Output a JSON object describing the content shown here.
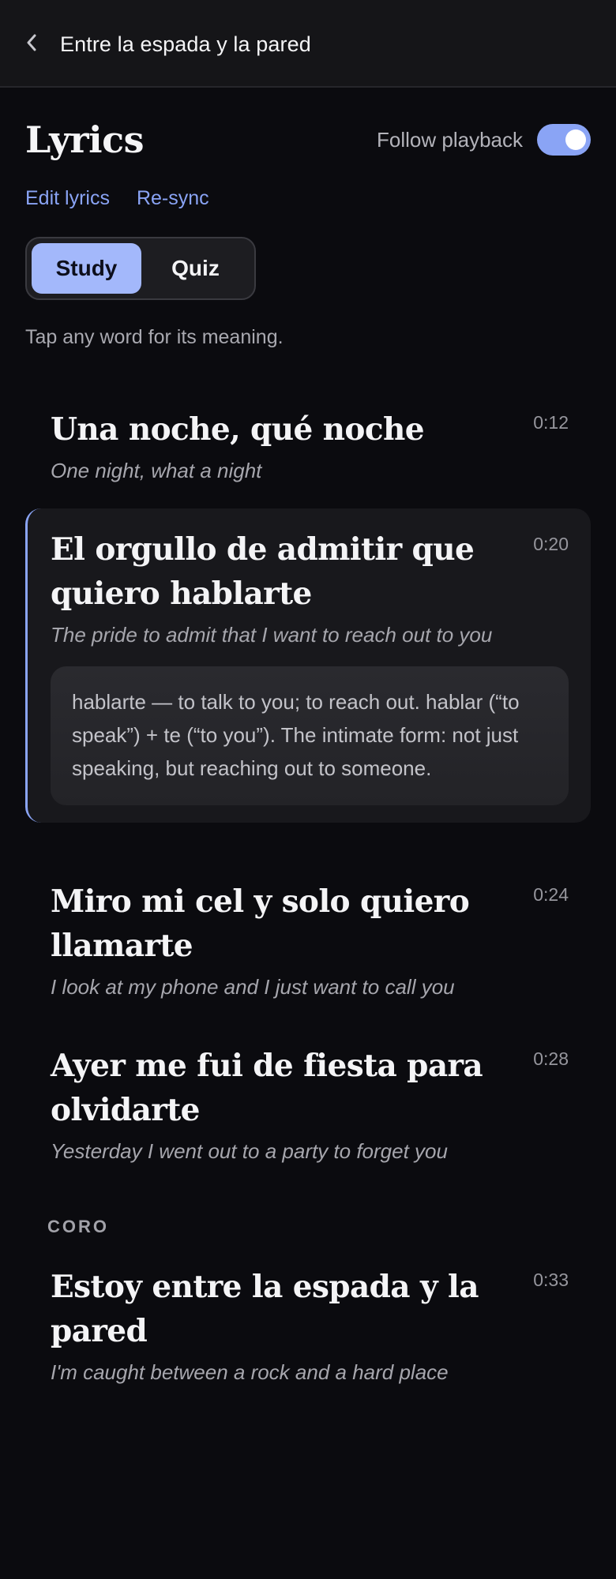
{
  "header": {
    "title": "Entre la espada y la pared",
    "back_icon": "chevron-left-icon"
  },
  "panel": {
    "heading": "Lyrics",
    "follow_playback_label": "Follow playback",
    "follow_playback_on": true,
    "links": [
      "Edit lyrics",
      "Re-sync"
    ],
    "modes": [
      "Study",
      "Quiz"
    ],
    "active_mode": "Study",
    "hint": "Tap any word for its meaning."
  },
  "colors": {
    "accent": "#8aa4f5",
    "active_segment": "#a3b8fb",
    "background": "#0b0b0f"
  },
  "lyrics": [
    {
      "text": "Una noche, qué noche",
      "translation": "One night, what a night",
      "time": "0:12"
    },
    {
      "text": "El orgullo de admitir que quiero hablarte",
      "translation": "The pride to admit that I want to reach out to you",
      "time": "0:20",
      "active": true,
      "gloss": "hablarte — to talk to you; to reach out. hablar (“to speak”) + te (“to you”). The intimate form: not just speaking, but reaching out to someone."
    },
    {
      "text": "Miro mi cel y solo quiero llamarte",
      "translation": "I look at my phone and I just want to call you",
      "time": "0:24"
    },
    {
      "text": "Ayer me fui de fiesta para olvidarte",
      "translation": "Yesterday I went out to a party to forget you",
      "time": "0:28"
    },
    {
      "section": "CORO",
      "text": "Estoy entre la espada y la pared",
      "translation": "I'm caught between a rock and a hard place",
      "time": "0:33"
    }
  ]
}
